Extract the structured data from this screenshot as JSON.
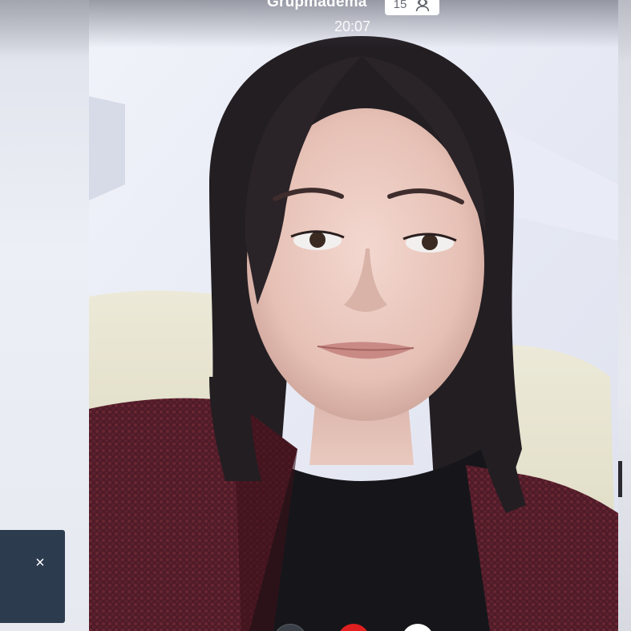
{
  "call": {
    "title": "Grupmadema",
    "participant_count": "15",
    "timer": "20:07",
    "participants_icon": "people-icon"
  },
  "toast": {
    "close_icon": "close-icon",
    "close_glyph": "×"
  },
  "controls": {
    "mute_icon": "microphone-icon",
    "hangup_icon": "hangup-icon",
    "video_icon": "camera-icon"
  },
  "colors": {
    "toast_bg": "#2d3b4f",
    "hangup": "#e02020",
    "badge_bg": "#ffffff"
  }
}
